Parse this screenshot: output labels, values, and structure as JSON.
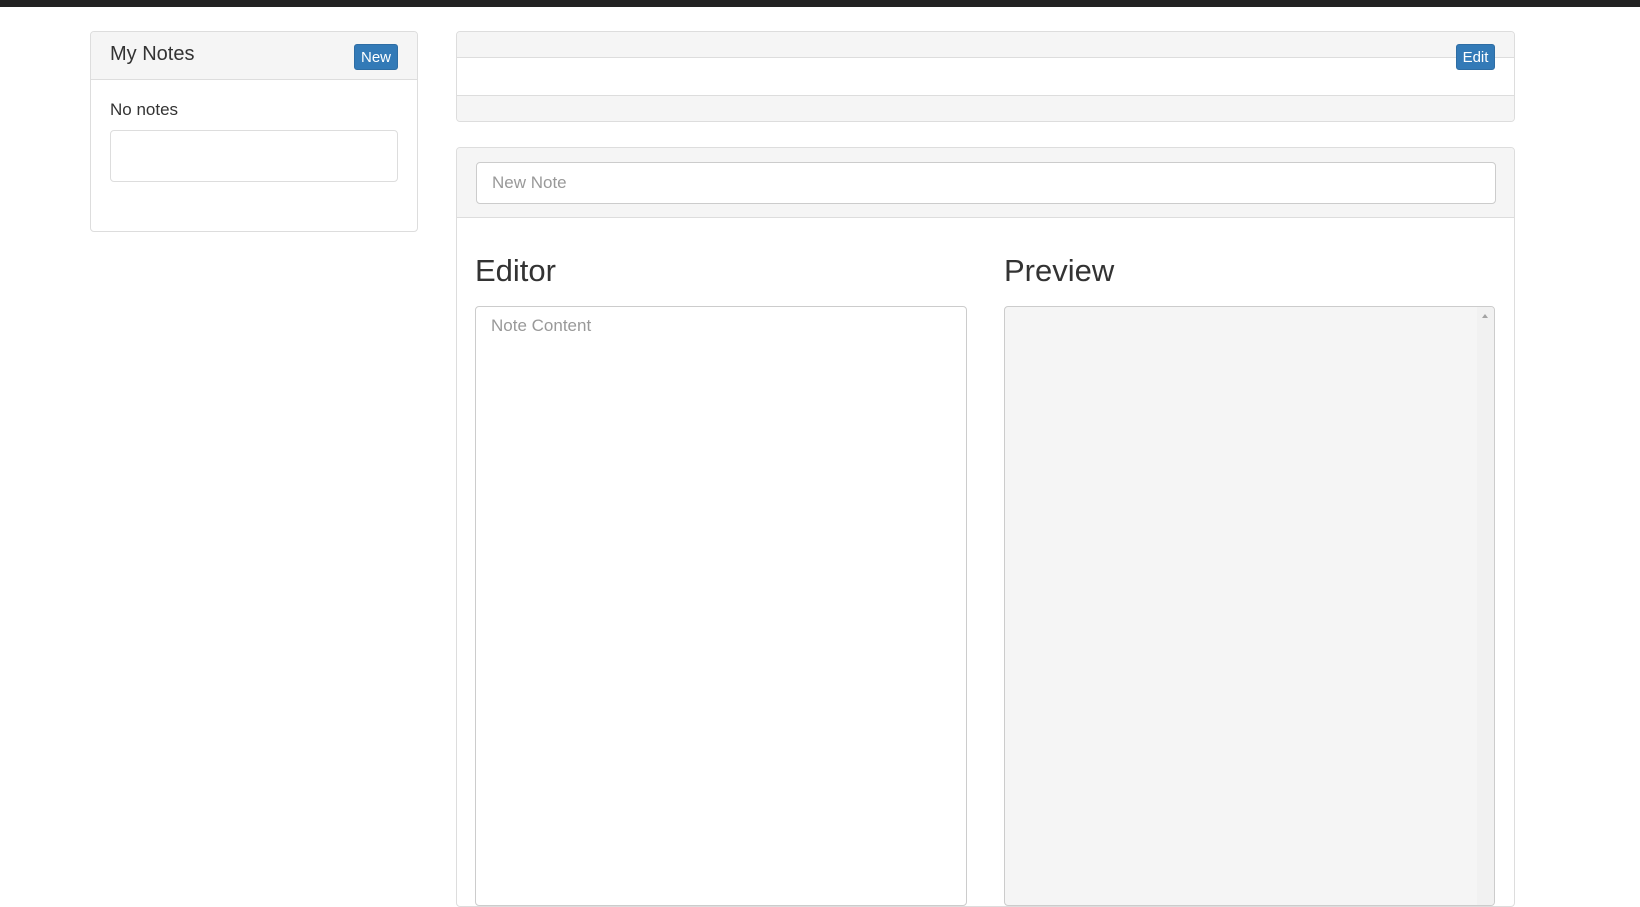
{
  "sidebar": {
    "title": "My Notes",
    "new_button_label": "New",
    "empty_message": "No notes"
  },
  "note_header": {
    "edit_button_label": "Edit"
  },
  "editor": {
    "title_placeholder": "New Note",
    "title_value": "",
    "editor_heading": "Editor",
    "preview_heading": "Preview",
    "content_placeholder": "Note Content",
    "content_value": ""
  },
  "colors": {
    "primary_button": "#337ab7",
    "top_bar": "#222222",
    "panel_heading": "#f5f5f5"
  },
  "icons": {
    "scroll_up": "scroll-up-icon"
  }
}
